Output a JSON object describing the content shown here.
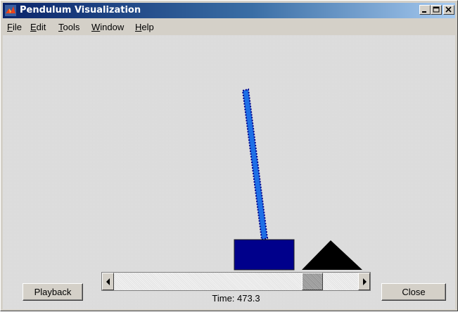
{
  "window": {
    "title": "Pendulum Visualization",
    "icon": "matlab-logo-icon"
  },
  "title_buttons": {
    "minimize_icon": "minimize-icon",
    "maximize_icon": "maximize-icon",
    "close_icon": "close-icon"
  },
  "menu": {
    "items": [
      {
        "label": "File",
        "mnemonic": "F"
      },
      {
        "label": "Edit",
        "mnemonic": "E"
      },
      {
        "label": "Tools",
        "mnemonic": "T"
      },
      {
        "label": "Window",
        "mnemonic": "W"
      },
      {
        "label": "Help",
        "mnemonic": "H"
      }
    ]
  },
  "controls": {
    "playback_label": "Playback",
    "close_label": "Close",
    "time_label": "Time: 473.3",
    "scroll_position_fraction": 0.77
  },
  "colors": {
    "titlebar_start": "#0a246a",
    "titlebar_end": "#a6caf0",
    "pendulum_rod": "#1e6fe6",
    "cart": "#00008b",
    "triangle": "#000000",
    "background": "#d8d8d8"
  }
}
